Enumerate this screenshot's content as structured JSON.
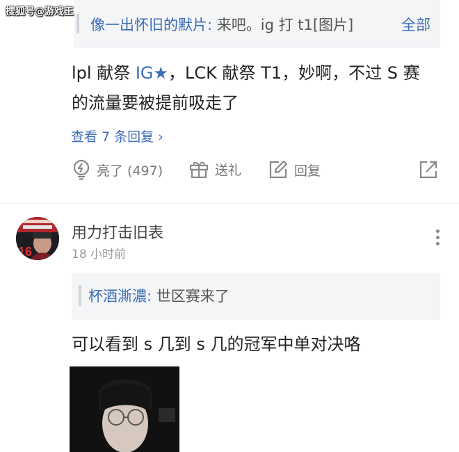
{
  "watermark": "搜狐号@游戏王",
  "top_quote": {
    "author": "像一出怀旧的默片:",
    "text": " 来吧。ig 打 t1[图片]",
    "view_all": "全部"
  },
  "comment1": {
    "line1_prefix": "lpl 献祭 ",
    "line1_tag": "IG★",
    "line1_suffix": "，LCK 献祭 T1，妙啊，不过 S 赛",
    "line2": "的流量要被提前吸走了",
    "view_replies": "查看 7 条回复 ›"
  },
  "actions": {
    "like": "亮了 (497)",
    "gift": "送礼",
    "reply": "回复"
  },
  "comment2": {
    "username": "用力打击旧表",
    "timestamp": "18 小时前",
    "quote_author": "杯酒澌濃:",
    "quote_text": " 世区赛来了",
    "text": "可以看到 s 几到 s 几的冠军中单对决咯"
  },
  "colors": {
    "link": "#3d6db5",
    "quote_bg": "#f4f5f7"
  }
}
